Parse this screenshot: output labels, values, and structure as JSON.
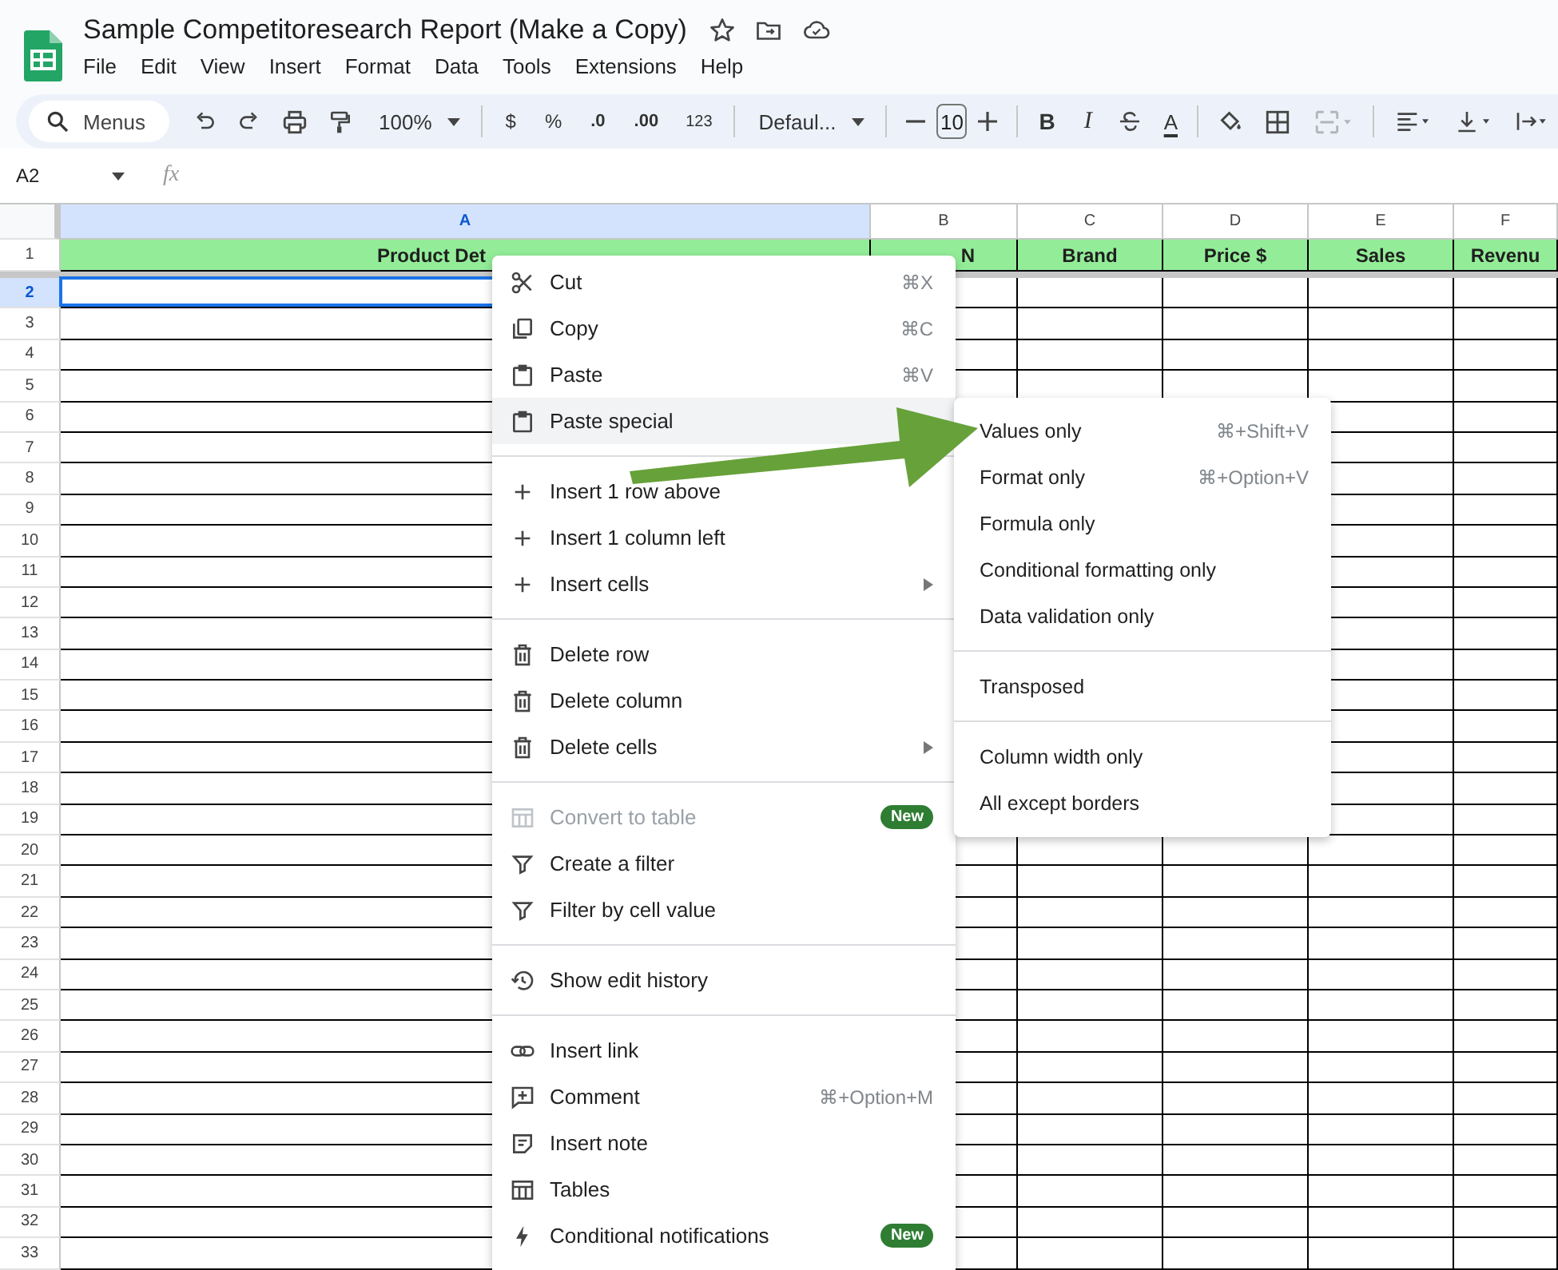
{
  "document": {
    "title": "Sample Competitoresearch Report (Make a Copy)"
  },
  "menu_bar": [
    "File",
    "Edit",
    "View",
    "Insert",
    "Format",
    "Data",
    "Tools",
    "Extensions",
    "Help"
  ],
  "toolbar": {
    "search": "Menus",
    "zoom": "100%",
    "currency": "$",
    "percent": "%",
    "decrease_decimal": ".0",
    "increase_decimal": ".00",
    "number_format": "123",
    "font": "Defaul...",
    "font_size": "10",
    "bold": "B",
    "italic": "I",
    "text_color": "A",
    "merge_disabled": true
  },
  "formula_bar": {
    "cell_ref": "A2",
    "fx": "fx"
  },
  "grid": {
    "columns": [
      {
        "label": "A",
        "selected": true
      },
      {
        "label": "B",
        "selected": false
      },
      {
        "label": "C",
        "selected": false
      },
      {
        "label": "D",
        "selected": false
      },
      {
        "label": "E",
        "selected": false
      },
      {
        "label": "F",
        "selected": false
      }
    ],
    "header_row": {
      "label": "1",
      "cells": [
        "Product Det",
        "N",
        "Brand",
        "Price $",
        "Sales",
        "Revenu"
      ]
    },
    "rows": [
      {
        "label": "2",
        "selected": true
      },
      {
        "label": "3",
        "selected": false
      },
      {
        "label": "4",
        "selected": false
      },
      {
        "label": "5",
        "selected": false
      },
      {
        "label": "6",
        "selected": false
      },
      {
        "label": "7",
        "selected": false
      },
      {
        "label": "8",
        "selected": false
      },
      {
        "label": "9",
        "selected": false
      },
      {
        "label": "10",
        "selected": false
      },
      {
        "label": "11",
        "selected": false
      },
      {
        "label": "12",
        "selected": false
      },
      {
        "label": "13",
        "selected": false
      },
      {
        "label": "14",
        "selected": false
      },
      {
        "label": "15",
        "selected": false
      },
      {
        "label": "16",
        "selected": false
      },
      {
        "label": "17",
        "selected": false
      },
      {
        "label": "18",
        "selected": false
      },
      {
        "label": "19",
        "selected": false
      },
      {
        "label": "20",
        "selected": false
      },
      {
        "label": "21",
        "selected": false
      },
      {
        "label": "22",
        "selected": false
      },
      {
        "label": "23",
        "selected": false
      },
      {
        "label": "24",
        "selected": false
      },
      {
        "label": "25",
        "selected": false
      },
      {
        "label": "26",
        "selected": false
      },
      {
        "label": "27",
        "selected": false
      },
      {
        "label": "28",
        "selected": false
      },
      {
        "label": "29",
        "selected": false
      },
      {
        "label": "30",
        "selected": false
      },
      {
        "label": "31",
        "selected": false
      },
      {
        "label": "32",
        "selected": false
      },
      {
        "label": "33",
        "selected": false
      }
    ]
  },
  "context_menu": {
    "items": [
      {
        "kind": "item",
        "label": "Cut",
        "shortcut": "⌘X",
        "submenu": false,
        "disabled": false,
        "selected": false
      },
      {
        "kind": "item",
        "label": "Copy",
        "shortcut": "⌘C",
        "submenu": false,
        "disabled": false,
        "selected": false
      },
      {
        "kind": "item",
        "label": "Paste",
        "shortcut": "⌘V",
        "submenu": false,
        "disabled": false,
        "selected": false
      },
      {
        "kind": "item",
        "label": "Paste special",
        "submenu": true,
        "disabled": false,
        "selected": true
      },
      {
        "kind": "separator"
      },
      {
        "kind": "item",
        "label": "Insert 1 row above",
        "submenu": false,
        "disabled": false,
        "selected": false
      },
      {
        "kind": "item",
        "label": "Insert 1 column left",
        "submenu": false,
        "disabled": false,
        "selected": false
      },
      {
        "kind": "item",
        "label": "Insert cells",
        "submenu": true,
        "disabled": false,
        "selected": false
      },
      {
        "kind": "separator"
      },
      {
        "kind": "item",
        "label": "Delete row",
        "submenu": false,
        "disabled": false,
        "selected": false
      },
      {
        "kind": "item",
        "label": "Delete column",
        "submenu": false,
        "disabled": false,
        "selected": false
      },
      {
        "kind": "item",
        "label": "Delete cells",
        "submenu": true,
        "disabled": false,
        "selected": false
      },
      {
        "kind": "separator"
      },
      {
        "kind": "item",
        "label": "Convert to table",
        "badge": "New",
        "submenu": false,
        "disabled": true,
        "selected": false
      },
      {
        "kind": "item",
        "label": "Create a filter",
        "submenu": false,
        "disabled": false,
        "selected": false
      },
      {
        "kind": "item",
        "label": "Filter by cell value",
        "submenu": false,
        "disabled": false,
        "selected": false
      },
      {
        "kind": "separator"
      },
      {
        "kind": "item",
        "label": "Show edit history",
        "submenu": false,
        "disabled": false,
        "selected": false
      },
      {
        "kind": "separator"
      },
      {
        "kind": "item",
        "label": "Insert link",
        "submenu": false,
        "disabled": false,
        "selected": false
      },
      {
        "kind": "item",
        "label": "Comment",
        "shortcut": "⌘+Option+M",
        "submenu": false,
        "disabled": false,
        "selected": false
      },
      {
        "kind": "item",
        "label": "Insert note",
        "submenu": false,
        "disabled": false,
        "selected": false
      },
      {
        "kind": "item",
        "label": "Tables",
        "submenu": false,
        "disabled": false,
        "selected": false
      },
      {
        "kind": "item",
        "label": "Conditional notifications",
        "badge": "New",
        "submenu": false,
        "disabled": false,
        "selected": false
      }
    ]
  },
  "paste_special_menu": {
    "items": [
      {
        "kind": "item",
        "label": "Values only",
        "shortcut": "⌘+Shift+V"
      },
      {
        "kind": "item",
        "label": "Format only",
        "shortcut": "⌘+Option+V"
      },
      {
        "kind": "item",
        "label": "Formula only"
      },
      {
        "kind": "item",
        "label": "Conditional formatting only"
      },
      {
        "kind": "item",
        "label": "Data validation only"
      },
      {
        "kind": "separator"
      },
      {
        "kind": "item",
        "label": "Transposed"
      },
      {
        "kind": "separator"
      },
      {
        "kind": "item",
        "label": "Column width only"
      },
      {
        "kind": "item",
        "label": "All except borders"
      }
    ]
  }
}
